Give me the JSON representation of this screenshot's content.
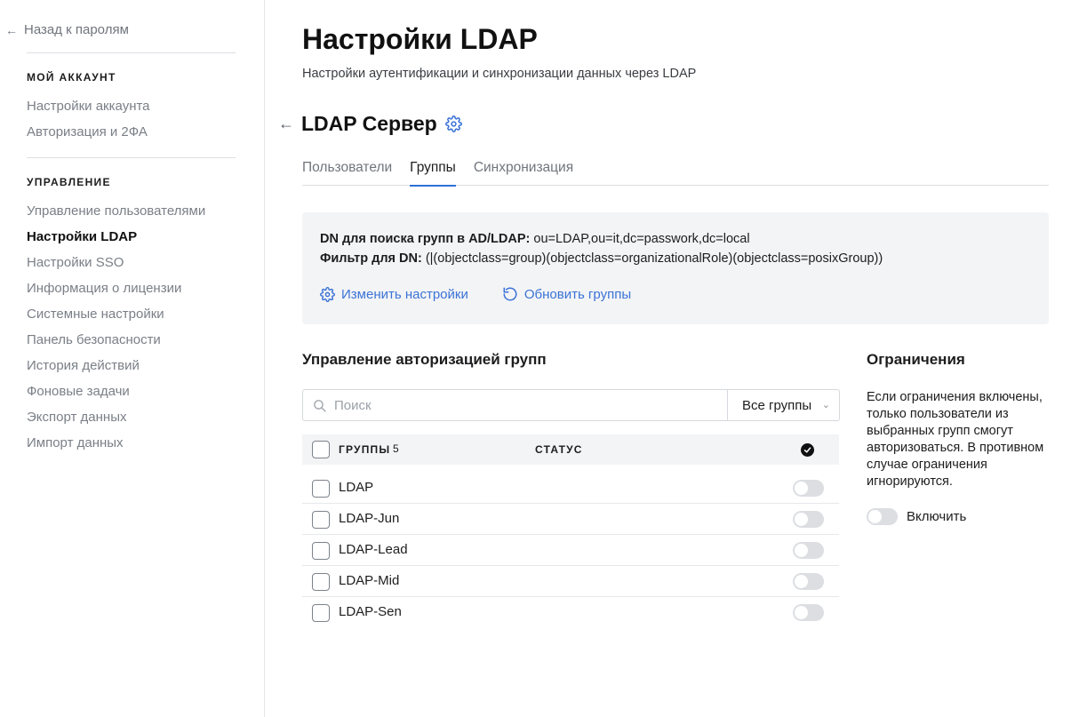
{
  "sidebar": {
    "back_label": "Назад к паролям",
    "account_section": {
      "title": "МОЙ АККАУНТ",
      "items": [
        {
          "label": "Настройки аккаунта"
        },
        {
          "label": "Авторизация и 2ФА"
        }
      ]
    },
    "management_section": {
      "title": "УПРАВЛЕНИЕ",
      "items": [
        {
          "label": "Управление пользователями"
        },
        {
          "label": "Настройки LDAP",
          "active": true
        },
        {
          "label": "Настройки SSO"
        },
        {
          "label": "Информация о лицензии"
        },
        {
          "label": "Системные настройки"
        },
        {
          "label": "Панель безопасности"
        },
        {
          "label": "История действий"
        },
        {
          "label": "Фоновые задачи"
        },
        {
          "label": "Экспорт данных"
        },
        {
          "label": "Импорт данных"
        }
      ]
    }
  },
  "header": {
    "title": "Настройки LDAP",
    "subtitle": "Настройки аутентификации и синхронизации данных через LDAP"
  },
  "server": {
    "title": "LDAP Сервер",
    "tabs": [
      {
        "label": "Пользователи"
      },
      {
        "label": "Группы",
        "active": true
      },
      {
        "label": "Синхронизация"
      }
    ]
  },
  "info": {
    "dn_label": "DN для поиска групп в AD/LDAP:",
    "dn_value": " ou=LDAP,ou=it,dc=passwork,dc=local",
    "filter_label": "Фильтр для DN:",
    "filter_value": " (|(objectclass=group)(objectclass=organizationalRole)(objectclass=posixGroup))",
    "change_settings_label": "Изменить настройки",
    "refresh_groups_label": "Обновить группы"
  },
  "groups": {
    "title": "Управление авторизацией групп",
    "search_placeholder": "Поиск",
    "filter_selected": "Все группы",
    "columns": {
      "groups": "ГРУППЫ",
      "count": "5",
      "status": "СТАТУС"
    },
    "rows": [
      {
        "name": "LDAP",
        "enabled": false
      },
      {
        "name": "LDAP-Jun",
        "enabled": false
      },
      {
        "name": "LDAP-Lead",
        "enabled": false
      },
      {
        "name": "LDAP-Mid",
        "enabled": false
      },
      {
        "name": "LDAP-Sen",
        "enabled": false
      }
    ]
  },
  "limits": {
    "title": "Ограничения",
    "description": "Если ограничения включены, только пользователи из выбранных групп смогут авторизоваться. В противном случае ограничения игнорируются.",
    "toggle_label": "Включить",
    "enabled": false
  },
  "colors": {
    "accent": "#2f6fd8",
    "link": "#3b73d6",
    "panel_bg": "#f3f4f6"
  }
}
